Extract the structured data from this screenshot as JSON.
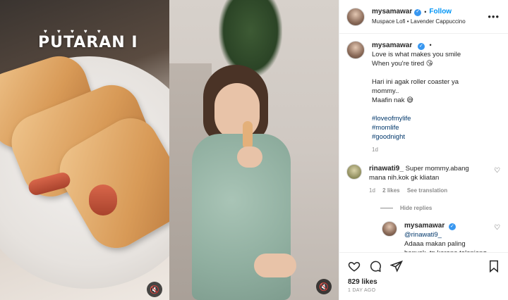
{
  "media": {
    "left_overlay_title": "PUTARAN I",
    "mute_icon": "speaker-muted-icon"
  },
  "header": {
    "username": "mysamawar",
    "separator": "•",
    "follow_label": "Follow",
    "audio_info": "Muspace Lofi • Lavender Cappuccino",
    "more_icon": "more-options-icon"
  },
  "caption": {
    "username": "mysamawar",
    "separator": "•",
    "lines": [
      "Love is what makes you smile",
      "When you're tired 😘"
    ],
    "lines2": [
      "Hari ini agak roller coaster ya",
      "mommy..",
      "Maafin nak 😅"
    ],
    "hashtags": [
      "#loveofmylife",
      "#momlife",
      "#goodnight"
    ],
    "age": "1d"
  },
  "comment": {
    "username": "rinawati9_",
    "text": "Super mommy.abang mana nih.kok gk kliatan",
    "age": "1d",
    "likes": "2 likes",
    "translate": "See translation"
  },
  "hide_replies": "Hide replies",
  "reply": {
    "username": "mysamawar",
    "mention": "@rinawati9_",
    "text": "Adaaa makan paling banyak. tp karena telanjang"
  },
  "actions": {
    "likes": "829 likes",
    "time": "1 DAY AGO"
  }
}
